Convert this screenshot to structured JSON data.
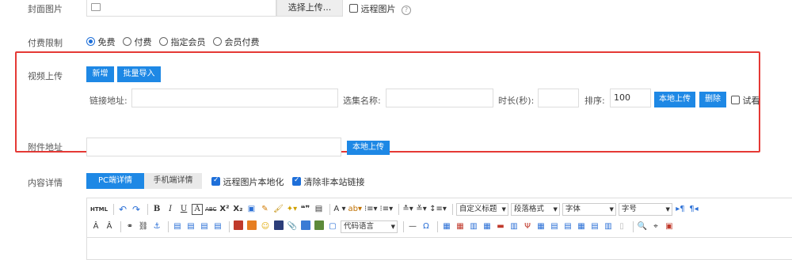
{
  "cover": {
    "label": "封面图片",
    "select_btn": "选择上传...",
    "remote_label": "远程图片",
    "help": "?"
  },
  "pay": {
    "label": "付费限制",
    "options": [
      "免费",
      "付费",
      "指定会员",
      "会员付费"
    ]
  },
  "video": {
    "label": "视频上传",
    "add_btn": "新增",
    "batch_btn": "批量导入",
    "link_label": "链接地址:",
    "episode_label": "选集名称:",
    "duration_label": "时长(秒):",
    "order_label": "排序:",
    "order_value": "100",
    "local_upload_btn": "本地上传",
    "delete_btn": "删除",
    "trial_label": "试看"
  },
  "attachment": {
    "label": "附件地址",
    "upload_btn": "本地上传"
  },
  "content": {
    "label": "内容详情",
    "tabs": [
      "PC端详情",
      "手机端详情"
    ],
    "remote_local_label": "远程图片本地化",
    "clear_links_label": "清除非本站链接"
  },
  "toolbar": {
    "html": "HTML",
    "bold": "B",
    "italic": "I",
    "underline": "U",
    "box": "A",
    "strike": "ABC",
    "sup": "X²",
    "sub": "X₂",
    "quote": "❝❞",
    "font_color": "A",
    "heading": "自定义标题",
    "paragraph": "段落格式",
    "font_family": "字体",
    "font_size": "字号",
    "code_lang": "代码语言",
    "hr": "—",
    "omega": "Ω"
  }
}
